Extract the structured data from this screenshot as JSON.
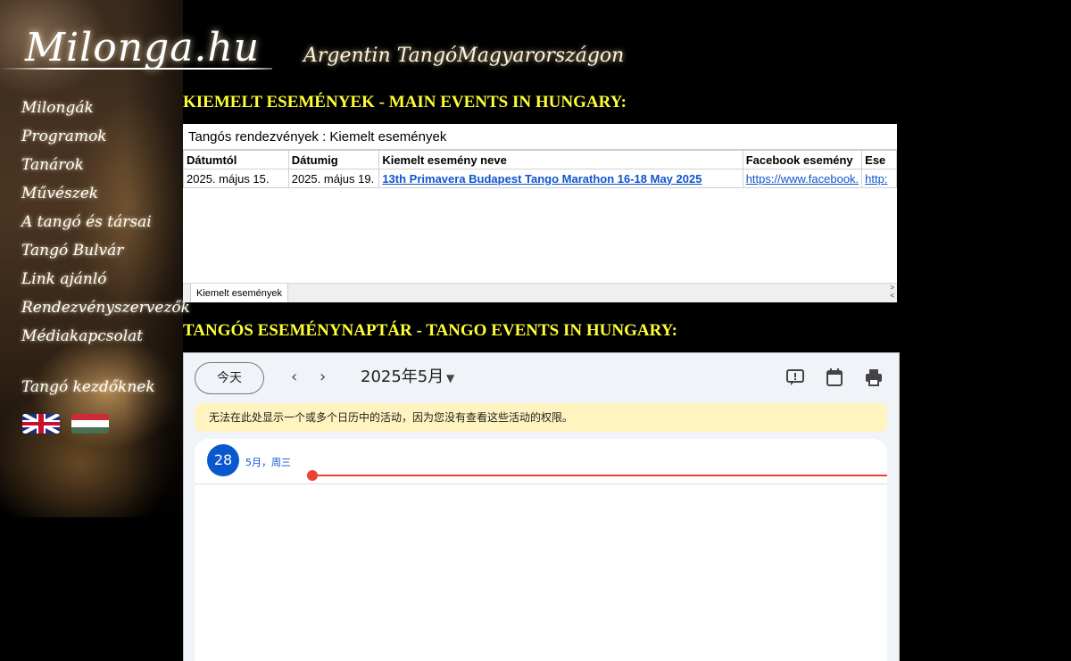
{
  "site": {
    "logo": "Milonga.hu",
    "tagline": "Argentin TangóMagyarországon"
  },
  "nav": {
    "items": [
      {
        "label": "Milongák"
      },
      {
        "label": "Programok"
      },
      {
        "label": "Tanárok"
      },
      {
        "label": "Művészek"
      },
      {
        "label": "A tangó és társai"
      },
      {
        "label": "Tangó Bulvár"
      },
      {
        "label": "Link ajánló"
      },
      {
        "label": "Rendezvényszervezők"
      },
      {
        "label": "Médiakapcsolat"
      }
    ],
    "beginners": "Tangó kezdőknek",
    "flags": [
      "english-flag",
      "hungarian-flag"
    ]
  },
  "main_events": {
    "heading": "KIEMELT ESEMÉNYEK - MAIN EVENTS IN HUNGARY:",
    "sheet_title": "Tangós rendezvények : Kiemelt események",
    "columns": [
      "Dátumtól",
      "Dátumig",
      "Kiemelt esemény neve",
      "Facebook esemény",
      "Ese"
    ],
    "rows": [
      [
        "2025. május 15.",
        "2025. május 19.",
        "13th Primavera Budapest Tango Marathon 16-18 May 2025",
        "https://www.facebook.",
        "http:"
      ]
    ],
    "tab_label": "Kiemelt események"
  },
  "calendar": {
    "heading": "TANGÓS ESEMÉNYNAPTÁR - TANGO EVENTS IN HUNGARY:",
    "today_button": "今天",
    "month": "2025年5月",
    "banner": "无法在此处显示一个或多个日历中的活动，因为您没有查看这些活动的权限。",
    "day_number": "28",
    "day_label": "5月，周三",
    "colors": {
      "accent": "#0b57d0",
      "now_line": "#ea4335",
      "banner_bg": "#fff4c0"
    }
  },
  "colors": {
    "heading": "#ffff33",
    "background": "#000000"
  }
}
